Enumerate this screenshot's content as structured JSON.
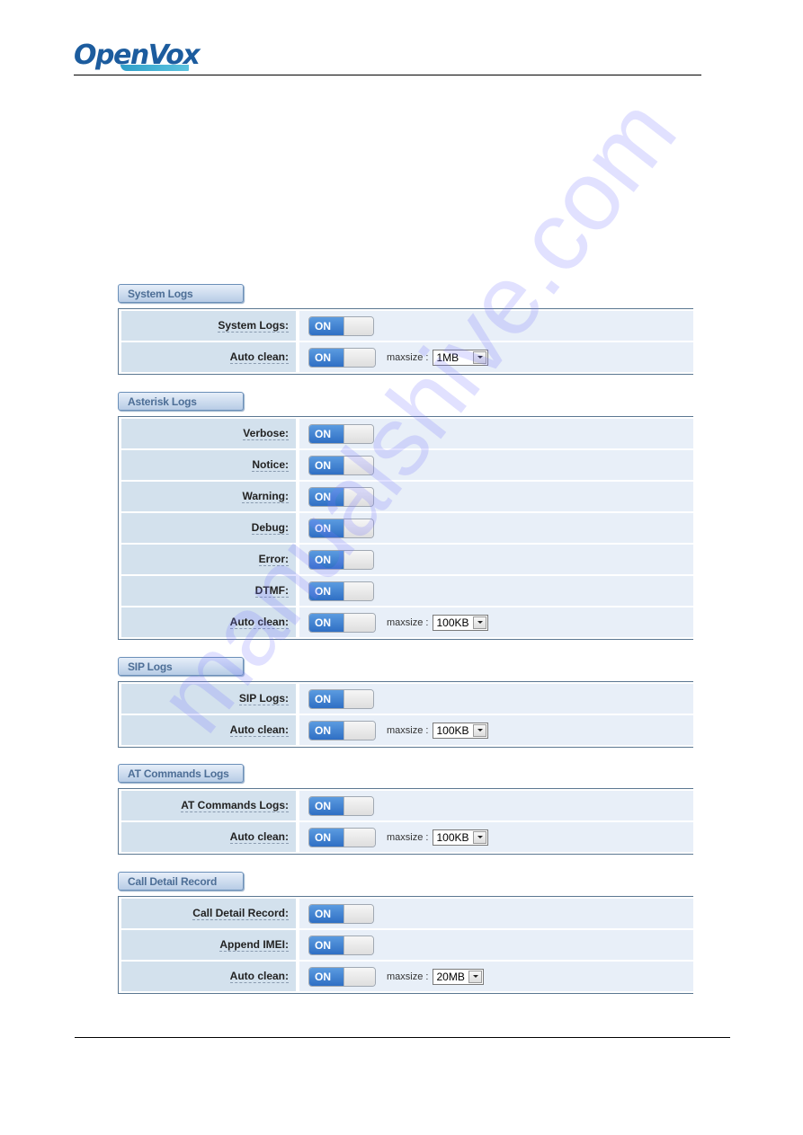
{
  "brand": {
    "logo_part1": "Open",
    "logo_part2": "Vox"
  },
  "watermark": "manualshive.com",
  "sections": [
    {
      "title": "System Logs",
      "rows": [
        {
          "label": "System Logs:",
          "toggle": "ON"
        },
        {
          "label": "Auto clean:",
          "toggle": "ON",
          "maxsize_label": "maxsize :",
          "maxsize_value": "1MB"
        }
      ]
    },
    {
      "title": "Asterisk Logs",
      "rows": [
        {
          "label": "Verbose:",
          "toggle": "ON"
        },
        {
          "label": "Notice:",
          "toggle": "ON"
        },
        {
          "label": "Warning:",
          "toggle": "ON"
        },
        {
          "label": "Debug:",
          "toggle": "ON"
        },
        {
          "label": "Error:",
          "toggle": "ON"
        },
        {
          "label": "DTMF:",
          "toggle": "ON"
        },
        {
          "label": "Auto clean:",
          "toggle": "ON",
          "maxsize_label": "maxsize :",
          "maxsize_value": "100KB"
        }
      ]
    },
    {
      "title": "SIP Logs",
      "rows": [
        {
          "label": "SIP Logs:",
          "toggle": "ON"
        },
        {
          "label": "Auto clean:",
          "toggle": "ON",
          "maxsize_label": "maxsize :",
          "maxsize_value": "100KB"
        }
      ]
    },
    {
      "title": "AT Commands Logs",
      "rows": [
        {
          "label": "AT Commands Logs:",
          "toggle": "ON"
        },
        {
          "label": "Auto clean:",
          "toggle": "ON",
          "maxsize_label": "maxsize :",
          "maxsize_value": "100KB"
        }
      ]
    },
    {
      "title": "Call Detail Record",
      "rows": [
        {
          "label": "Call Detail Record:",
          "toggle": "ON"
        },
        {
          "label": "Append IMEI:",
          "toggle": "ON"
        },
        {
          "label": "Auto clean:",
          "toggle": "ON",
          "maxsize_label": "maxsize :",
          "maxsize_value": "20MB"
        }
      ]
    }
  ]
}
